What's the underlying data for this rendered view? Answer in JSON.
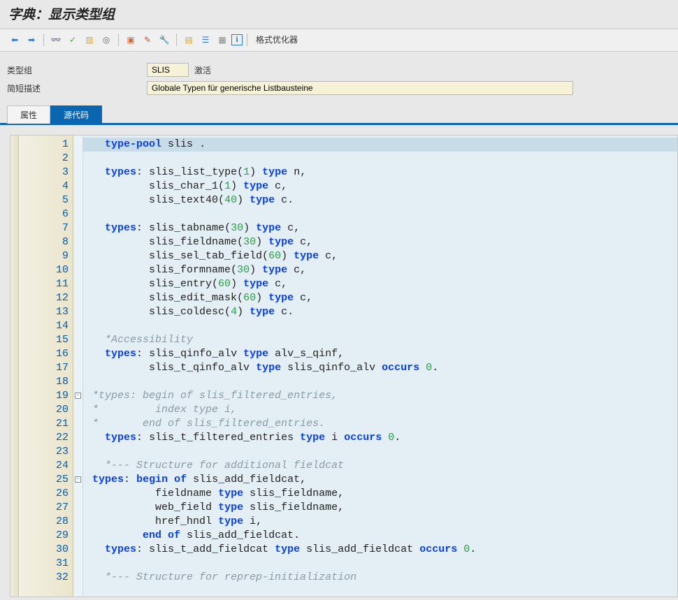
{
  "title": "字典：显示类型组",
  "toolbar": {
    "back_icon": "⬅",
    "fwd_icon": "➡",
    "glasses_icon": "👓",
    "check_icon": "✓",
    "struct_icon": "▥",
    "spiral_icon": "◎",
    "tree1_icon": "▣",
    "wand_icon": "✎",
    "wrench_icon": "🔧",
    "hier_icon": "▤",
    "graph_icon": "☰",
    "grid_icon": "▦",
    "info_icon": "i",
    "pretty_label": "格式优化器"
  },
  "form": {
    "type_group_label": "类型组",
    "type_group_value": "SLIS",
    "status": "激活",
    "short_desc_label": "简短描述",
    "short_desc_value": "Globale Typen für generische Listbausteine"
  },
  "tabs": {
    "attr": "属性",
    "src": "源代码"
  },
  "code": {
    "lines": [
      {
        "n": 1,
        "hl": true,
        "seg": [
          [
            "sp",
            "   "
          ],
          [
            "kw",
            "type-pool"
          ],
          [
            "sp",
            " "
          ],
          [
            "id",
            "slis"
          ],
          [
            "sp",
            " "
          ],
          [
            "p",
            "."
          ]
        ]
      },
      {
        "n": 2,
        "seg": []
      },
      {
        "n": 3,
        "seg": [
          [
            "sp",
            "   "
          ],
          [
            "kw",
            "types"
          ],
          [
            "p",
            ":"
          ],
          [
            "sp",
            " "
          ],
          [
            "id",
            "slis_list_type"
          ],
          [
            "p",
            "("
          ],
          [
            "num",
            "1"
          ],
          [
            "p",
            ")"
          ],
          [
            "sp",
            " "
          ],
          [
            "kw",
            "type"
          ],
          [
            "sp",
            " "
          ],
          [
            "id",
            "n"
          ],
          [
            "p",
            ","
          ]
        ]
      },
      {
        "n": 4,
        "seg": [
          [
            "sp",
            "          "
          ],
          [
            "id",
            "slis_char_1"
          ],
          [
            "p",
            "("
          ],
          [
            "num",
            "1"
          ],
          [
            "p",
            ")"
          ],
          [
            "sp",
            " "
          ],
          [
            "kw",
            "type"
          ],
          [
            "sp",
            " "
          ],
          [
            "id",
            "c"
          ],
          [
            "p",
            ","
          ]
        ]
      },
      {
        "n": 5,
        "seg": [
          [
            "sp",
            "          "
          ],
          [
            "id",
            "slis_text40"
          ],
          [
            "p",
            "("
          ],
          [
            "num",
            "40"
          ],
          [
            "p",
            ")"
          ],
          [
            "sp",
            " "
          ],
          [
            "kw",
            "type"
          ],
          [
            "sp",
            " "
          ],
          [
            "id",
            "c"
          ],
          [
            "p",
            "."
          ]
        ]
      },
      {
        "n": 6,
        "seg": []
      },
      {
        "n": 7,
        "seg": [
          [
            "sp",
            "   "
          ],
          [
            "kw",
            "types"
          ],
          [
            "p",
            ":"
          ],
          [
            "sp",
            " "
          ],
          [
            "id",
            "slis_tabname"
          ],
          [
            "p",
            "("
          ],
          [
            "num",
            "30"
          ],
          [
            "p",
            ")"
          ],
          [
            "sp",
            " "
          ],
          [
            "kw",
            "type"
          ],
          [
            "sp",
            " "
          ],
          [
            "id",
            "c"
          ],
          [
            "p",
            ","
          ]
        ]
      },
      {
        "n": 8,
        "seg": [
          [
            "sp",
            "          "
          ],
          [
            "id",
            "slis_fieldname"
          ],
          [
            "p",
            "("
          ],
          [
            "num",
            "30"
          ],
          [
            "p",
            ")"
          ],
          [
            "sp",
            " "
          ],
          [
            "kw",
            "type"
          ],
          [
            "sp",
            " "
          ],
          [
            "id",
            "c"
          ],
          [
            "p",
            ","
          ]
        ]
      },
      {
        "n": 9,
        "seg": [
          [
            "sp",
            "          "
          ],
          [
            "id",
            "slis_sel_tab_field"
          ],
          [
            "p",
            "("
          ],
          [
            "num",
            "60"
          ],
          [
            "p",
            ")"
          ],
          [
            "sp",
            " "
          ],
          [
            "kw",
            "type"
          ],
          [
            "sp",
            " "
          ],
          [
            "id",
            "c"
          ],
          [
            "p",
            ","
          ]
        ]
      },
      {
        "n": 10,
        "seg": [
          [
            "sp",
            "          "
          ],
          [
            "id",
            "slis_formname"
          ],
          [
            "p",
            "("
          ],
          [
            "num",
            "30"
          ],
          [
            "p",
            ")"
          ],
          [
            "sp",
            " "
          ],
          [
            "kw",
            "type"
          ],
          [
            "sp",
            " "
          ],
          [
            "id",
            "c"
          ],
          [
            "p",
            ","
          ]
        ]
      },
      {
        "n": 11,
        "seg": [
          [
            "sp",
            "          "
          ],
          [
            "id",
            "slis_entry"
          ],
          [
            "p",
            "("
          ],
          [
            "num",
            "60"
          ],
          [
            "p",
            ")"
          ],
          [
            "sp",
            " "
          ],
          [
            "kw",
            "type"
          ],
          [
            "sp",
            " "
          ],
          [
            "id",
            "c"
          ],
          [
            "p",
            ","
          ]
        ]
      },
      {
        "n": 12,
        "seg": [
          [
            "sp",
            "          "
          ],
          [
            "id",
            "slis_edit_mask"
          ],
          [
            "p",
            "("
          ],
          [
            "num",
            "60"
          ],
          [
            "p",
            ")"
          ],
          [
            "sp",
            " "
          ],
          [
            "kw",
            "type"
          ],
          [
            "sp",
            " "
          ],
          [
            "id",
            "c"
          ],
          [
            "p",
            ","
          ]
        ]
      },
      {
        "n": 13,
        "seg": [
          [
            "sp",
            "          "
          ],
          [
            "id",
            "slis_coldesc"
          ],
          [
            "p",
            "("
          ],
          [
            "num",
            "4"
          ],
          [
            "p",
            ")"
          ],
          [
            "sp",
            " "
          ],
          [
            "kw",
            "type"
          ],
          [
            "sp",
            " "
          ],
          [
            "id",
            "c"
          ],
          [
            "p",
            "."
          ]
        ]
      },
      {
        "n": 14,
        "seg": []
      },
      {
        "n": 15,
        "seg": [
          [
            "sp",
            "   "
          ],
          [
            "cm",
            "*Accessibility"
          ]
        ]
      },
      {
        "n": 16,
        "seg": [
          [
            "sp",
            "   "
          ],
          [
            "kw",
            "types"
          ],
          [
            "p",
            ":"
          ],
          [
            "sp",
            " "
          ],
          [
            "id",
            "slis_qinfo_alv"
          ],
          [
            "sp",
            " "
          ],
          [
            "kw",
            "type"
          ],
          [
            "sp",
            " "
          ],
          [
            "id",
            "alv_s_qinf"
          ],
          [
            "p",
            ","
          ]
        ]
      },
      {
        "n": 17,
        "seg": [
          [
            "sp",
            "          "
          ],
          [
            "id",
            "slis_t_qinfo_alv"
          ],
          [
            "sp",
            " "
          ],
          [
            "kw",
            "type"
          ],
          [
            "sp",
            " "
          ],
          [
            "id",
            "slis_qinfo_alv"
          ],
          [
            "sp",
            " "
          ],
          [
            "kw",
            "occurs"
          ],
          [
            "sp",
            " "
          ],
          [
            "num",
            "0"
          ],
          [
            "p",
            "."
          ]
        ]
      },
      {
        "n": 18,
        "seg": []
      },
      {
        "n": 19,
        "fold": true,
        "seg": [
          [
            "sp",
            " "
          ],
          [
            "cm",
            "*types: begin of slis_filtered_entries,"
          ]
        ]
      },
      {
        "n": 20,
        "seg": [
          [
            "sp",
            " "
          ],
          [
            "cm",
            "*         index type i,"
          ]
        ]
      },
      {
        "n": 21,
        "seg": [
          [
            "sp",
            " "
          ],
          [
            "cm",
            "*       end of slis_filtered_entries."
          ]
        ]
      },
      {
        "n": 22,
        "seg": [
          [
            "sp",
            "   "
          ],
          [
            "kw",
            "types"
          ],
          [
            "p",
            ":"
          ],
          [
            "sp",
            " "
          ],
          [
            "id",
            "slis_t_filtered_entries"
          ],
          [
            "sp",
            " "
          ],
          [
            "kw",
            "type"
          ],
          [
            "sp",
            " "
          ],
          [
            "id",
            "i"
          ],
          [
            "sp",
            " "
          ],
          [
            "kw",
            "occurs"
          ],
          [
            "sp",
            " "
          ],
          [
            "num",
            "0"
          ],
          [
            "p",
            "."
          ]
        ]
      },
      {
        "n": 23,
        "seg": []
      },
      {
        "n": 24,
        "seg": [
          [
            "sp",
            "   "
          ],
          [
            "cm",
            "*--- Structure for additional fieldcat"
          ]
        ]
      },
      {
        "n": 25,
        "fold": true,
        "seg": [
          [
            "sp",
            " "
          ],
          [
            "kw",
            "types"
          ],
          [
            "p",
            ":"
          ],
          [
            "sp",
            " "
          ],
          [
            "kw",
            "begin of"
          ],
          [
            "sp",
            " "
          ],
          [
            "id",
            "slis_add_fieldcat"
          ],
          [
            "p",
            ","
          ]
        ]
      },
      {
        "n": 26,
        "seg": [
          [
            "sp",
            "           "
          ],
          [
            "id",
            "fieldname"
          ],
          [
            "sp",
            " "
          ],
          [
            "kw",
            "type"
          ],
          [
            "sp",
            " "
          ],
          [
            "id",
            "slis_fieldname"
          ],
          [
            "p",
            ","
          ]
        ]
      },
      {
        "n": 27,
        "seg": [
          [
            "sp",
            "           "
          ],
          [
            "id",
            "web_field"
          ],
          [
            "sp",
            " "
          ],
          [
            "kw",
            "type"
          ],
          [
            "sp",
            " "
          ],
          [
            "id",
            "slis_fieldname"
          ],
          [
            "p",
            ","
          ]
        ]
      },
      {
        "n": 28,
        "seg": [
          [
            "sp",
            "           "
          ],
          [
            "id",
            "href_hndl"
          ],
          [
            "sp",
            " "
          ],
          [
            "kw",
            "type"
          ],
          [
            "sp",
            " "
          ],
          [
            "id",
            "i"
          ],
          [
            "p",
            ","
          ]
        ]
      },
      {
        "n": 29,
        "seg": [
          [
            "sp",
            "         "
          ],
          [
            "kw",
            "end of"
          ],
          [
            "sp",
            " "
          ],
          [
            "id",
            "slis_add_fieldcat"
          ],
          [
            "p",
            "."
          ]
        ]
      },
      {
        "n": 30,
        "seg": [
          [
            "sp",
            "   "
          ],
          [
            "kw",
            "types"
          ],
          [
            "p",
            ":"
          ],
          [
            "sp",
            " "
          ],
          [
            "id",
            "slis_t_add_fieldcat"
          ],
          [
            "sp",
            " "
          ],
          [
            "kw",
            "type"
          ],
          [
            "sp",
            " "
          ],
          [
            "id",
            "slis_add_fieldcat"
          ],
          [
            "sp",
            " "
          ],
          [
            "kw",
            "occurs"
          ],
          [
            "sp",
            " "
          ],
          [
            "num",
            "0"
          ],
          [
            "p",
            "."
          ]
        ]
      },
      {
        "n": 31,
        "seg": []
      },
      {
        "n": 32,
        "seg": [
          [
            "sp",
            "   "
          ],
          [
            "cm",
            "*--- Structure for reprep-initialization"
          ]
        ]
      }
    ]
  }
}
